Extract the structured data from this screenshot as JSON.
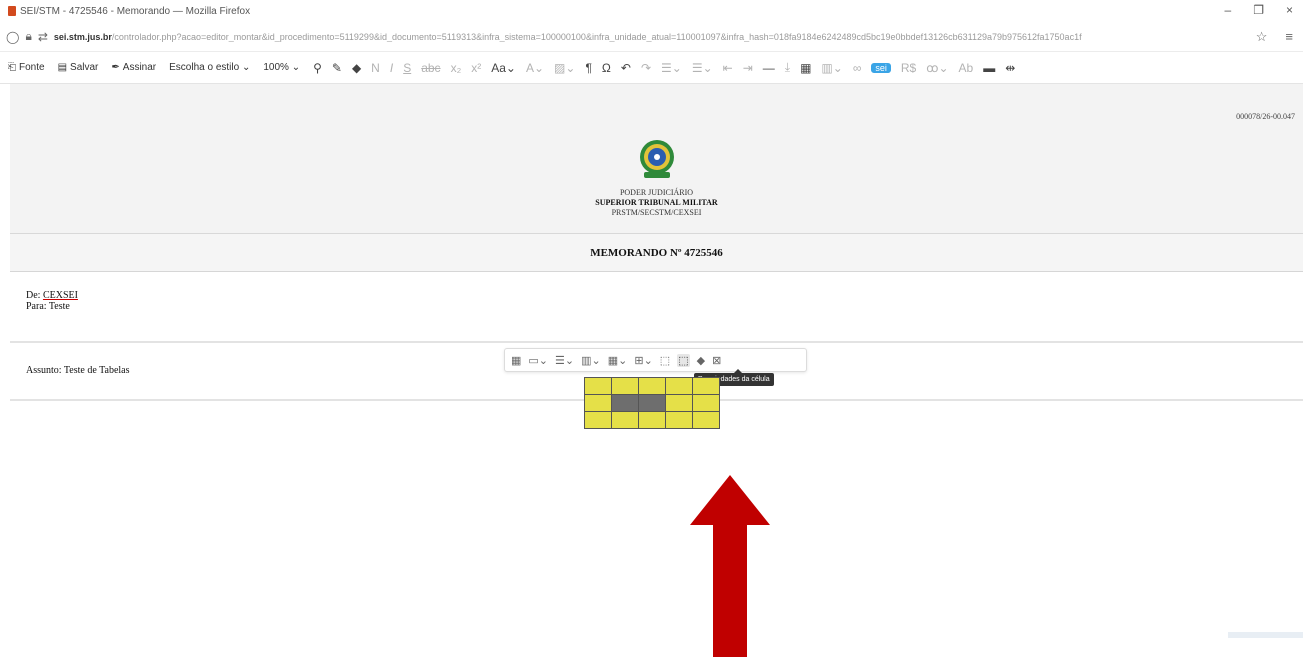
{
  "window": {
    "title": "SEI/STM - 4725546 - Memorando — Mozilla Firefox",
    "controls": [
      "–",
      "❐",
      "×"
    ]
  },
  "urlbar": {
    "domain": "sei.stm.jus.br",
    "path": "/controlador.php?acao=editor_montar&id_procedimento=5119299&id_documento=5119313&infra_sistema=100000100&infra_unidade_atual=110001097&infra_hash=018fa9184e6242489cd5bc19e0bbdef13126cb631129a79b975612fa1750ac1f",
    "icons": [
      "shield-icon",
      "lock-icon",
      "permissions-icon",
      "star-icon",
      "menu-icon"
    ]
  },
  "toolbar": {
    "fonte_label": "Fonte",
    "salvar_label": "Salvar",
    "assinar_label": "Assinar",
    "estilo_label": "Escolha o estilo ⌄",
    "zoom_label": "100% ⌄",
    "icons": [
      "find-replace-icon",
      "brush-icon",
      "eraser-icon",
      "bold-icon",
      "italic-icon",
      "underline-icon",
      "strikethrough-icon",
      "subscript-icon",
      "superscript-icon",
      "font-size-icon",
      "font-color-icon",
      "background-color-icon",
      "paragraph-icon",
      "omega-icon",
      "undo-icon",
      "redo-icon",
      "numbered-list-icon",
      "bulleted-list-icon",
      "outdent-icon",
      "indent-icon",
      "horizontal-line-icon",
      "page-break-icon",
      "table-icon",
      "insert-table-icon",
      "link-icon",
      "sei-icon",
      "currency-icon",
      "spellcheck-icon",
      "abbreviation-icon",
      "comment-icon",
      "nonbreaking-icon"
    ]
  },
  "document": {
    "process_number": "000078/26-00.047",
    "header_line1": "PODER JUDICIÁRIO",
    "header_line2": "SUPERIOR TRIBUNAL MILITAR",
    "header_line3": "PRSTM/SECSTM/CEXSEI",
    "memo_title": "MEMORANDO Nº 4725546",
    "de_prefix": "De: ",
    "de_value": "CEXSEI",
    "para_text": "Para: Teste",
    "assunto_text": "Assunto: Teste de Tabelas"
  },
  "table_toolbar": {
    "tooltip": "Propriedades da célula",
    "icons": [
      "table-properties-icon",
      "table-column-icon",
      "table-row-icon",
      "merge-cells-icon",
      "split-cells-icon",
      "insert-column-icon",
      "cell-properties-icon",
      "table-cell-properties-icon",
      "remove-format-icon",
      "delete-table-icon"
    ]
  },
  "table": {
    "rows": 3,
    "cols": 5,
    "cell_color": "#e5e048",
    "selected_color": "#6e6e6e",
    "selected_cells": [
      [
        1,
        1
      ],
      [
        1,
        2
      ]
    ]
  },
  "annotation": {
    "arrow_color": "#c00000",
    "arrow_direction": "up"
  }
}
